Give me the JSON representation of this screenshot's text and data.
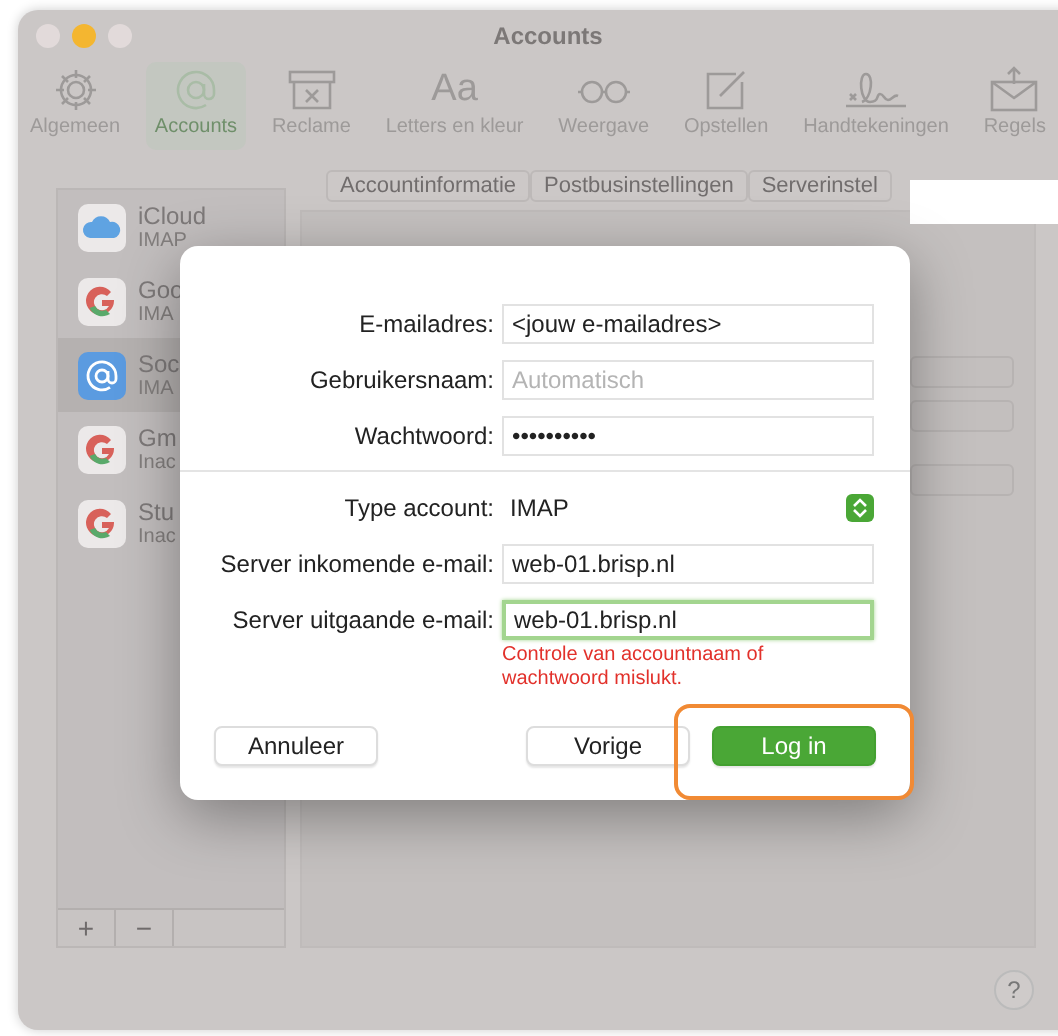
{
  "window": {
    "title": "Accounts"
  },
  "toolbar": {
    "items": [
      {
        "label": "Algemeen",
        "kind": "gear",
        "selected": false
      },
      {
        "label": "Accounts",
        "kind": "at",
        "selected": true
      },
      {
        "label": "Reclame",
        "kind": "junk",
        "selected": false
      },
      {
        "label": "Letters en kleur",
        "kind": "fonts",
        "glyph": "Aa",
        "selected": false
      },
      {
        "label": "Weergave",
        "kind": "glasses",
        "selected": false
      },
      {
        "label": "Opstellen",
        "kind": "compose",
        "selected": false
      },
      {
        "label": "Handtekeningen",
        "kind": "signature",
        "selected": false
      },
      {
        "label": "Regels",
        "kind": "rules",
        "selected": false
      }
    ]
  },
  "sidebar": {
    "accounts": [
      {
        "name": "iCloud",
        "type": "IMAP",
        "kind": "cloud",
        "selected": false
      },
      {
        "name": "Goo",
        "type": "IMA",
        "kind": "google",
        "selected": false
      },
      {
        "name": "Soc",
        "type": "IMA",
        "kind": "at",
        "selected": true
      },
      {
        "name": "Gm",
        "type": "Inac",
        "kind": "google",
        "selected": false
      },
      {
        "name": "Stu",
        "type": "Inac",
        "kind": "google",
        "selected": false
      }
    ],
    "buttons": [
      "+",
      "−"
    ]
  },
  "tabs": [
    {
      "label": "Accountinformatie",
      "selected": false
    },
    {
      "label": "Postbusinstellingen",
      "selected": false
    },
    {
      "label": "Serverinstel",
      "selected": false
    }
  ],
  "dialog": {
    "fields": [
      {
        "label": "E-mailadres:",
        "kind": "text",
        "value": "<jouw e-mailadres>",
        "focused": false
      },
      {
        "label": "Gebruikersnaam:",
        "kind": "text",
        "placeholder": "Automatisch",
        "focused": false
      },
      {
        "label": "Wachtwoord:",
        "kind": "text",
        "value": "••••••••••",
        "focused": false
      },
      {
        "label": "Type account:",
        "kind": "popup",
        "value": "IMAP"
      },
      {
        "label": "Server inkomende e-mail:",
        "kind": "text",
        "value": "web-01.brisp.nl",
        "focused": false
      },
      {
        "label": "Server uitgaande e-mail:",
        "kind": "text",
        "value": "web-01.brisp.nl",
        "focused": true
      }
    ],
    "error": "Controle van accountnaam of wachtwoord mislukt.",
    "buttons": [
      {
        "label": "Annuleer",
        "default": false,
        "highlighted": false
      },
      {
        "label": "Vorige",
        "default": false,
        "highlighted": false
      },
      {
        "label": "Log in",
        "default": true,
        "highlighted": true
      }
    ]
  },
  "help": "?"
}
